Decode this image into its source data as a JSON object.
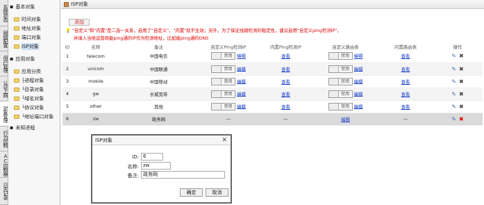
{
  "vtabs": [
    "系统状态",
    "网络配置",
    "用户管理",
    "认证上网",
    "对象管理",
    "行为控制",
    "AC控制器",
    "日志记录"
  ],
  "tree": {
    "basic_head": "基本对象",
    "basic_items": [
      "时间对象",
      "地址对象",
      "端口对象",
      "ISP对象"
    ],
    "app_head": "应用对象",
    "app_items": [
      "应用分类",
      "├进程对象",
      "└目录对象",
      "└域名对象",
      "└协议对象",
      "└地址端口对象"
    ],
    "unknown": "未知进程"
  },
  "page_title": "ISP对象",
  "add_label": "添加",
  "notice_line1": "\"自定义\"和\"内置\"是二选一关系，启用了\"自定义\"，\"内置\"就不生效；另外，为了保证线路检测的稳定性，建议启用\"自定义ping检测IP\"，",
  "notice_line2": "并填入当地运营商能ping通的IP作为检测地址，比如能ping通的DNS",
  "columns": {
    "id": "ID",
    "name": "名称",
    "remark": "备注",
    "custom_ping": "自定义Ping检测IP",
    "builtin_ping": "内置Ping检测IP",
    "custom_route": "自定义路由表",
    "builtin_route": "内置路由表",
    "ops": "操作"
  },
  "rows": [
    {
      "id": "1",
      "name": "telecom",
      "remark": "中国电信",
      "disable": "禁用",
      "edit": "编辑",
      "view": "查看",
      "route_disable": "禁用",
      "route_edit": "编辑",
      "route_view": "查看"
    },
    {
      "id": "2",
      "name": "unicom",
      "remark": "中国联通",
      "disable": "禁用",
      "edit": "编辑",
      "view": "查看",
      "route_disable": "禁用",
      "route_edit": "编辑",
      "route_view": "查看"
    },
    {
      "id": "3",
      "name": "mobile",
      "remark": "中国移动",
      "disable": "禁用",
      "edit": "编辑",
      "view": "查看",
      "route_disable": "禁用",
      "route_edit": "编辑",
      "route_view": "查看"
    },
    {
      "id": "4",
      "name": "gw",
      "remark": "长城宽带",
      "disable": "禁用",
      "edit": "编辑",
      "view": "查看",
      "route_disable": "禁用",
      "route_edit": "编辑",
      "route_view": "查看"
    },
    {
      "id": "5",
      "name": "other",
      "remark": "其他",
      "disable": "禁用",
      "edit": "编辑",
      "view": "查看",
      "route_disable": "禁用",
      "route_edit": "编辑",
      "route_view": "查看"
    },
    {
      "id": "6",
      "name": "zw",
      "remark": "政务网",
      "dash1": "—",
      "dash2": "—",
      "route_edit": "编辑",
      "dash3": "—"
    }
  ],
  "dialog": {
    "title": "ISP对象",
    "close": "✕",
    "id_label": "ID:",
    "id_value": "6",
    "name_label": "名称:",
    "name_value": "zw",
    "remark_label": "备注:",
    "remark_value": "政务网",
    "ok": "确定",
    "cancel": "取消"
  }
}
